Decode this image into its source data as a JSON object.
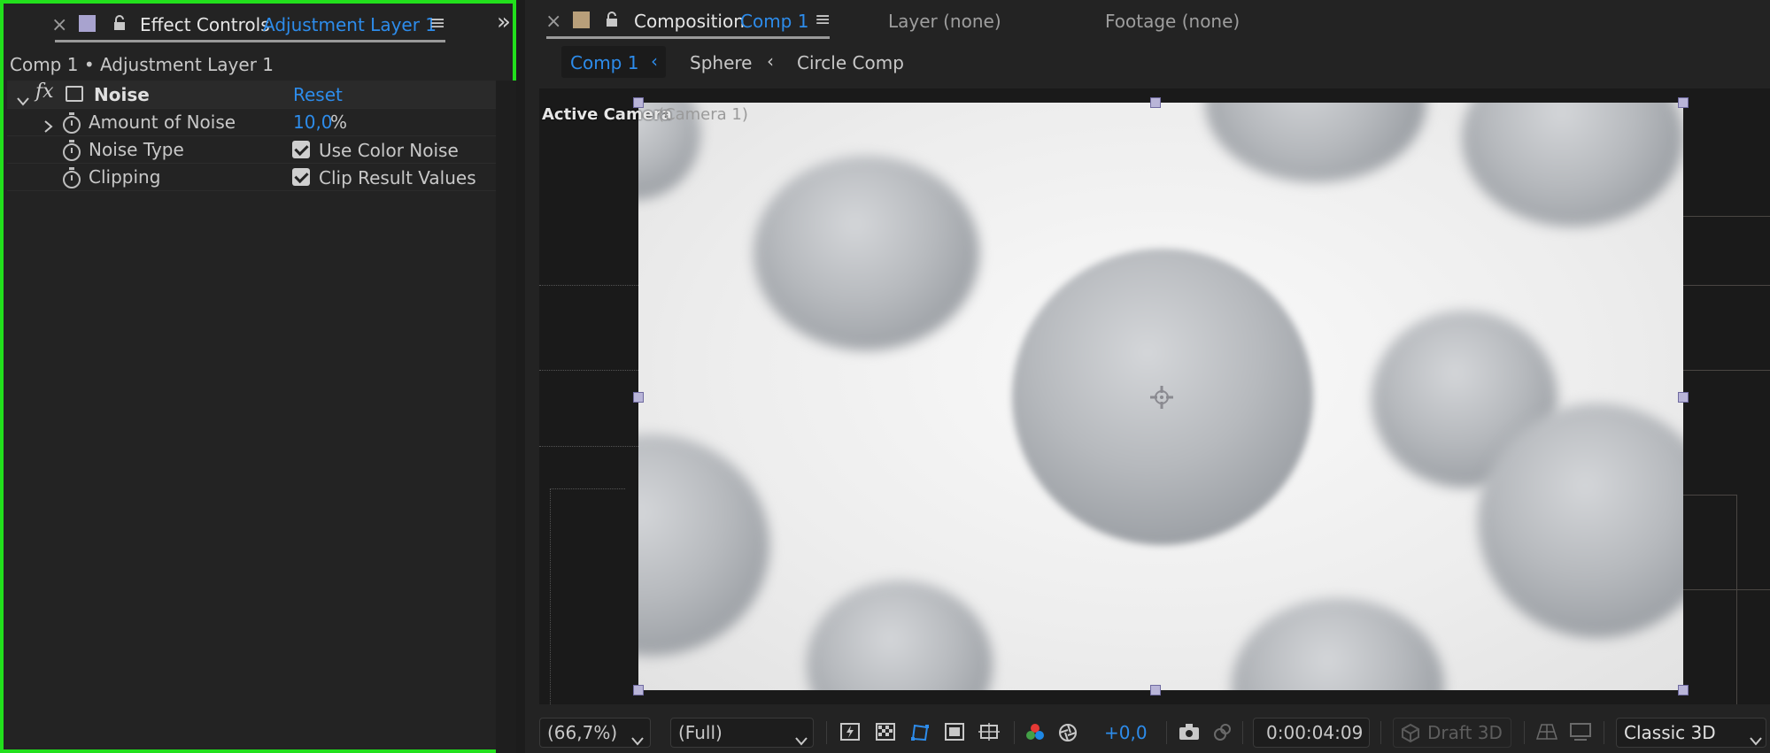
{
  "effect_controls": {
    "close": "×",
    "title": "Effect Controls",
    "layer_name": "Adjustment Layer 1",
    "menu": "≡",
    "collapse": "»",
    "breadcrumb": "Comp 1 • Adjustment Layer 1",
    "effect": {
      "fx_label": "fx",
      "name": "Noise",
      "reset": "Reset",
      "properties": [
        {
          "name": "Amount of Noise",
          "value": "10,0",
          "unit": "%"
        },
        {
          "name": "Noise Type",
          "checkbox_label": "Use Color Noise",
          "checked": true
        },
        {
          "name": "Clipping",
          "checkbox_label": "Clip Result Values",
          "checked": true
        }
      ]
    }
  },
  "composition": {
    "close": "×",
    "title": "Composition",
    "comp_name": "Comp 1",
    "menu": "≡",
    "layer_tab": "Layer (none)",
    "footage_tab": "Footage (none)",
    "breadcrumbs": [
      "Comp 1",
      "Sphere",
      "Circle Comp"
    ],
    "camera_label": "Active Camera",
    "camera_name": "(Camera 1)"
  },
  "footer": {
    "zoom": "(66,7%)",
    "resolution": "(Full)",
    "exposure": "+0,0",
    "timecode": "0:00:04:09",
    "draft3d": "Draft 3D",
    "renderer": "Classic 3D"
  },
  "colors": {
    "accent": "#2d8ceb",
    "panel_highlight": "#22e01c",
    "label_swatch_left": "#a8a3cf",
    "label_swatch_right": "#b89f7a"
  }
}
